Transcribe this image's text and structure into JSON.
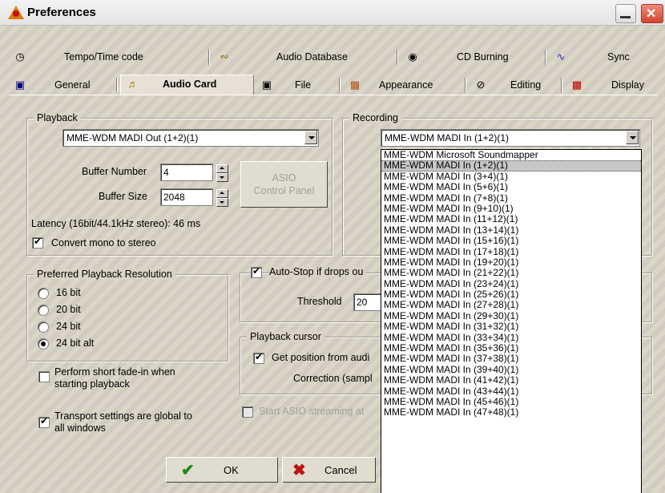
{
  "window": {
    "title": "Preferences"
  },
  "tabs_row1": [
    {
      "label": "Tempo/Time code",
      "icon": "clock-icon"
    },
    {
      "label": "Audio Database",
      "icon": "database-icon"
    },
    {
      "label": "CD Burning",
      "icon": "cd-icon"
    },
    {
      "label": "Sync",
      "icon": "sync-icon"
    }
  ],
  "tabs_row2": [
    {
      "label": "General",
      "icon": "monitor-icon"
    },
    {
      "label": "Audio Card",
      "icon": "speaker-icon",
      "active": true
    },
    {
      "label": "File",
      "icon": "floppy-icon"
    },
    {
      "label": "Appearance",
      "icon": "palette-icon"
    },
    {
      "label": "Editing",
      "icon": "edit-icon"
    },
    {
      "label": "Display",
      "icon": "display-icon"
    }
  ],
  "playback": {
    "title": "Playback",
    "device": "MME-WDM MADI Out (1+2)(1)",
    "buffer_number_label": "Buffer Number",
    "buffer_number": "4",
    "buffer_size_label": "Buffer Size",
    "buffer_size": "2048",
    "asio_button": "ASIO\nControl Panel",
    "latency": "Latency (16bit/44.1kHz stereo): 46 ms",
    "convert_mono": "Convert mono to stereo"
  },
  "recording": {
    "title": "Recording",
    "device": "MME-WDM MADI In (1+2)(1)",
    "options": [
      "MME-WDM Microsoft Soundmapper",
      "MME-WDM MADI In (1+2)(1)",
      "MME-WDM MADI In (3+4)(1)",
      "MME-WDM MADI In (5+6)(1)",
      "MME-WDM MADI In (7+8)(1)",
      "MME-WDM MADI In (9+10)(1)",
      "MME-WDM MADI In (11+12)(1)",
      "MME-WDM MADI In (13+14)(1)",
      "MME-WDM MADI In (15+16)(1)",
      "MME-WDM MADI In (17+18)(1)",
      "MME-WDM MADI In (19+20)(1)",
      "MME-WDM MADI In (21+22)(1)",
      "MME-WDM MADI In (23+24)(1)",
      "MME-WDM MADI In (25+26)(1)",
      "MME-WDM MADI In (27+28)(1)",
      "MME-WDM MADI In (29+30)(1)",
      "MME-WDM MADI In (31+32)(1)",
      "MME-WDM MADI In (33+34)(1)",
      "MME-WDM MADI In (35+36)(1)",
      "MME-WDM MADI In (37+38)(1)",
      "MME-WDM MADI In (39+40)(1)",
      "MME-WDM MADI In (41+42)(1)",
      "MME-WDM MADI In (43+44)(1)",
      "MME-WDM MADI In (45+46)(1)",
      "MME-WDM MADI In (47+48)(1)"
    ],
    "selected_index": 1
  },
  "resolution": {
    "title": "Preferred Playback Resolution",
    "options": [
      "16 bit",
      "20 bit",
      "24 bit",
      "24 bit alt"
    ],
    "selected_index": 3
  },
  "autostop": {
    "label": "Auto-Stop if drops ou",
    "threshold_label": "Threshold",
    "threshold": "20"
  },
  "cursor": {
    "title": "Playback cursor",
    "get_position": "Get position from audi",
    "correction": "Correction (sampl"
  },
  "fade_in": "Perform short fade-in when\nstarting playback",
  "transport": "Transport settings are global to\nall windows",
  "asio_streaming": "Start ASIO streaming at",
  "buttons": {
    "ok": "OK",
    "cancel": "Cancel"
  }
}
